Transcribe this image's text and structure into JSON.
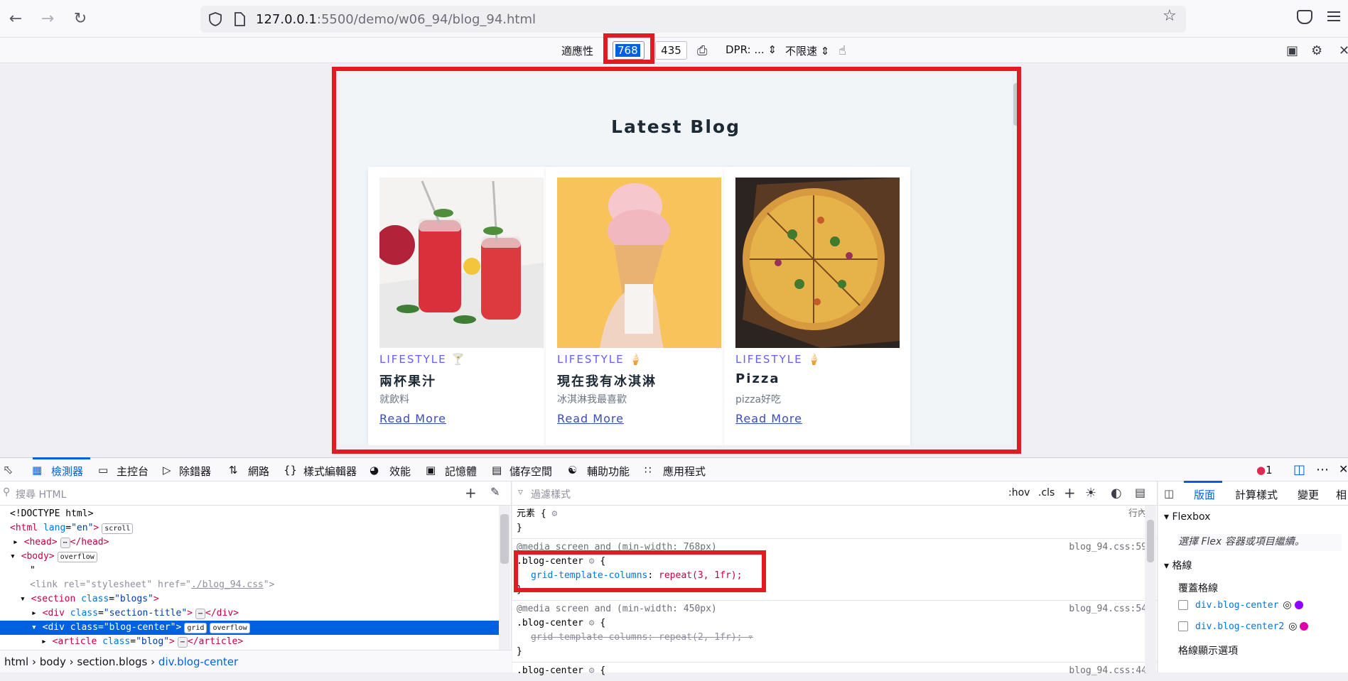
{
  "browser": {
    "url_host": "127.0.0.1",
    "url_rest": ":5500/demo/w06_94/blog_94.html"
  },
  "rdm": {
    "device": "適應性",
    "width": "768",
    "height": "435",
    "dpr": "DPR: ...",
    "throttle": "不限速"
  },
  "page": {
    "title": "Latest Blog",
    "cards": [
      {
        "category": "LIFESTYLE",
        "title": "兩杯果汁",
        "desc": "就飲料",
        "link": "Read More"
      },
      {
        "category": "LIFESTYLE",
        "title": "現在我有冰淇淋",
        "desc": "冰淇淋我最喜歡",
        "link": "Read More"
      },
      {
        "category": "LIFESTYLE",
        "title": "Pizza",
        "desc": "pizza好吃",
        "link": "Read More"
      }
    ]
  },
  "devtools": {
    "tabs": [
      "檢測器",
      "主控台",
      "除錯器",
      "網路",
      "樣式編輯器",
      "效能",
      "記憶體",
      "儲存空間",
      "輔助功能",
      "應用程式"
    ],
    "error_count": "1",
    "html_search_placeholder": "搜尋 HTML",
    "style_filter_placeholder": "過濾樣式",
    "hov": ":hov",
    "cls": ".cls",
    "html_lines": [
      "<!DOCTYPE html>",
      "<html lang=\"en\">",
      "<head>",
      "<body>",
      "\"",
      "<link rel=\"stylesheet\" href=\"./blog_94.css\">",
      "<section class=\"blogs\">",
      "<div class=\"section-title\">",
      "<div class=\"blog-center\">",
      "<article class=\"blog\">"
    ],
    "breadcrumb": [
      "html",
      "body",
      "section.blogs",
      "div.blog-center"
    ],
    "rules": {
      "element": "元素 {",
      "inline": "行內",
      "media1": "@media screen and (min-width: 768px)",
      "src1": "blog_94.css:59",
      "selector1": ".blog-center",
      "decl1_prop": "grid-template-columns",
      "decl1_val": "repeat(3, 1fr);",
      "media2": "@media screen and (min-width: 450px)",
      "src2": "blog_94.css:54",
      "selector2": ".blog-center",
      "decl2_prop": "grid-template-columns",
      "decl2_val": "repeat(2, 1fr);",
      "selector3": ".blog-center",
      "src3": "blog_94.css:44"
    },
    "right_tabs": [
      "版面",
      "計算樣式",
      "變更",
      "相"
    ],
    "flexbox_heading": "Flexbox",
    "flexbox_hint": "選擇 Flex 容器或項目繼續。",
    "grid_heading": "格線",
    "overlay_heading": "覆蓋格線",
    "grid_items": [
      {
        "name": "div.blog-center",
        "color": "#9400ff"
      },
      {
        "name": "div.blog-center2",
        "color": "#df00a9"
      }
    ],
    "grid_display": "格線顯示選項"
  }
}
